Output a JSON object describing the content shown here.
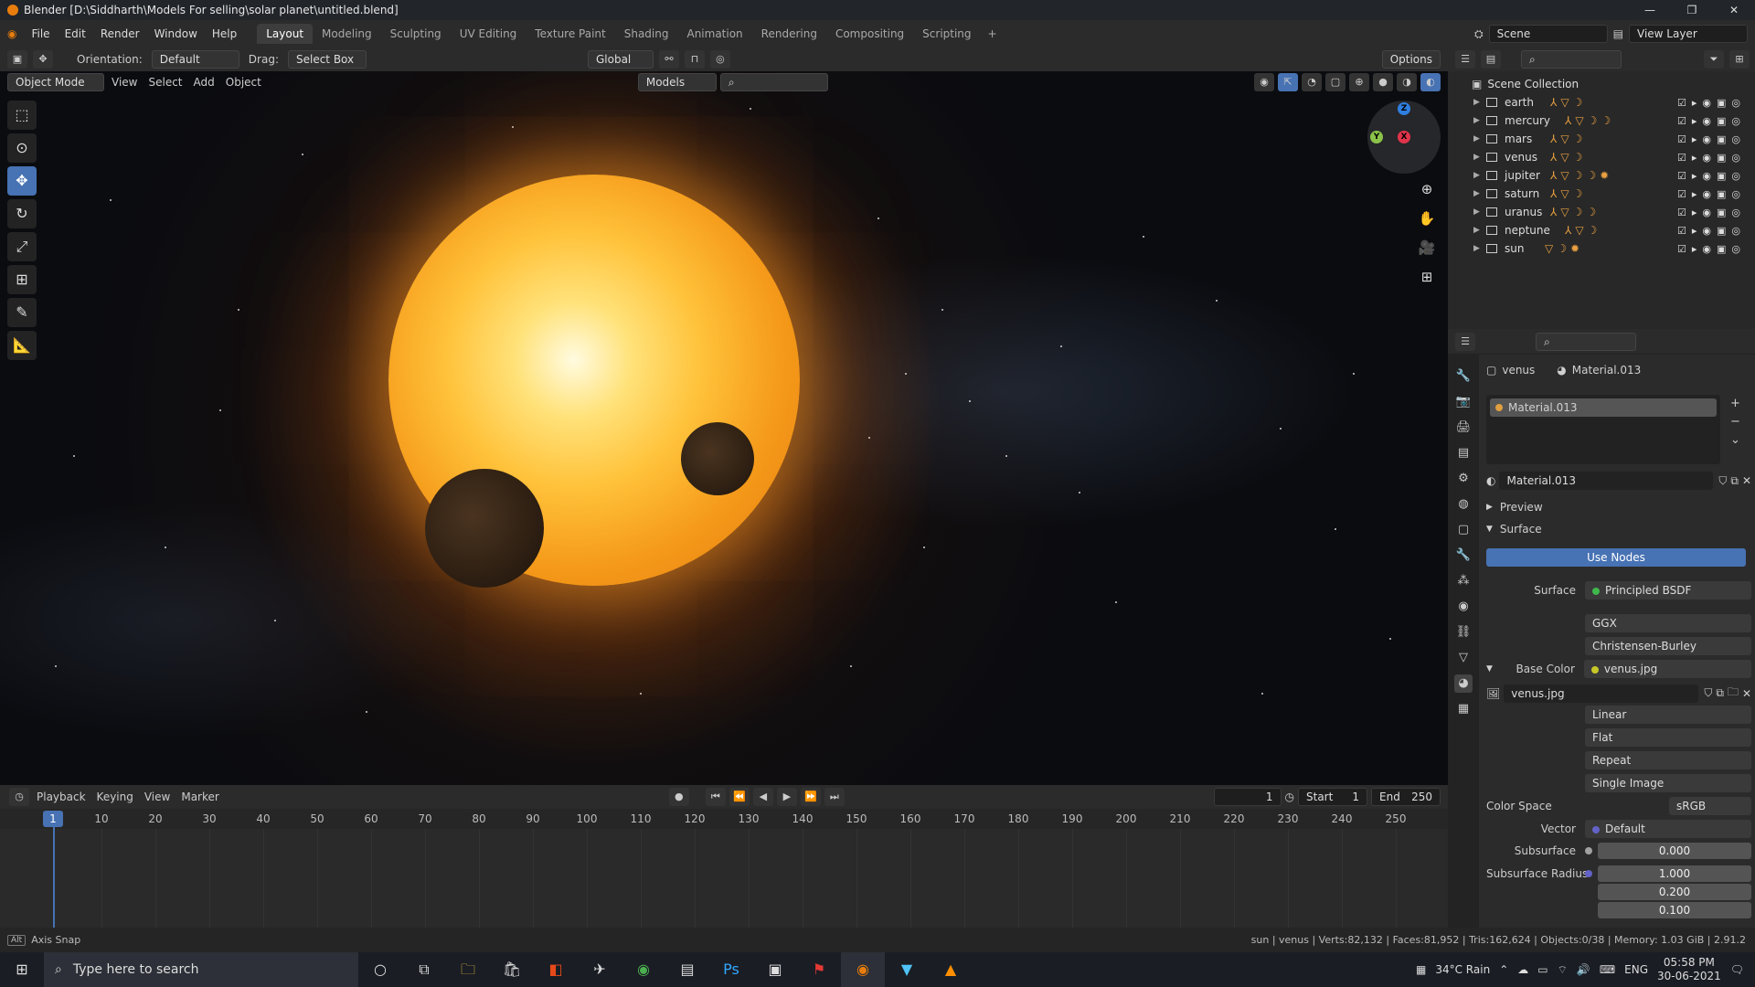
{
  "window": {
    "title": "Blender [D:\\Siddharth\\Models For selling\\solar planet\\untitled.blend]",
    "controls": [
      "—",
      "❐",
      "✕"
    ]
  },
  "menu": [
    "File",
    "Edit",
    "Render",
    "Window",
    "Help"
  ],
  "workspaces": [
    "Layout",
    "Modeling",
    "Sculpting",
    "UV Editing",
    "Texture Paint",
    "Shading",
    "Animation",
    "Rendering",
    "Compositing",
    "Scripting"
  ],
  "scene": {
    "name": "Scene",
    "view_layer": "View Layer"
  },
  "viewport_header": {
    "orientation_label": "Orientation:",
    "orientation_value": "Default",
    "drag_label": "Drag:",
    "drag_value": "Select Box",
    "transform": "Global",
    "options": "Options",
    "mode": "Object Mode",
    "view": "View",
    "select": "Select",
    "add": "Add",
    "object": "Object",
    "collection_filter": "Models"
  },
  "gizmo": {
    "z": "Z",
    "y": "Y",
    "x": "X"
  },
  "timeline": {
    "playback": "Playback",
    "keying": "Keying",
    "view": "View",
    "marker": "Marker",
    "current_frame": "1",
    "start_label": "Start",
    "start": "1",
    "end_label": "End",
    "end": "250",
    "ticks": [
      "10",
      "20",
      "30",
      "40",
      "50",
      "60",
      "70",
      "80",
      "90",
      "100",
      "110",
      "120",
      "130",
      "140",
      "150",
      "160",
      "170",
      "180",
      "190",
      "200",
      "210",
      "220",
      "230",
      "240",
      "250"
    ]
  },
  "status": {
    "left": "Axis Snap",
    "right": "sun | venus | Verts:82,132 | Faces:81,952 | Tris:162,624 | Objects:0/38 | Memory: 1.03 GiB | 2.91.2"
  },
  "outliner": {
    "root": "Scene Collection",
    "items": [
      "earth",
      "mercury",
      "mars",
      "venus",
      "jupiter",
      "saturn",
      "uranus",
      "neptune",
      "sun"
    ]
  },
  "properties": {
    "object": "venus",
    "material": "Material.013",
    "slot": "Material.013",
    "datablock": "Material.013",
    "preview": "Preview",
    "surface_panel": "Surface",
    "use_nodes": "Use Nodes",
    "surface_label": "Surface",
    "surface_value": "Principled BSDF",
    "distribution": "GGX",
    "subsurface_method": "Christensen-Burley",
    "base_color_label": "Base Color",
    "base_color_value": "venus.jpg",
    "image": "venus.jpg",
    "interpolation": "Linear",
    "projection": "Flat",
    "extension": "Repeat",
    "source": "Single Image",
    "color_space_label": "Color Space",
    "color_space_value": "sRGB",
    "vector_label": "Vector",
    "vector_value": "Default",
    "subsurface_label": "Subsurface",
    "subsurface_value": "0.000",
    "subsurface_radius_label": "Subsurface Radius",
    "radius": [
      "1.000",
      "0.200",
      "0.100"
    ]
  },
  "taskbar": {
    "search_placeholder": "Type here to search",
    "weather": "34°C Rain",
    "lang": "ENG",
    "time": "05:58 PM",
    "date": "30-06-2021"
  }
}
